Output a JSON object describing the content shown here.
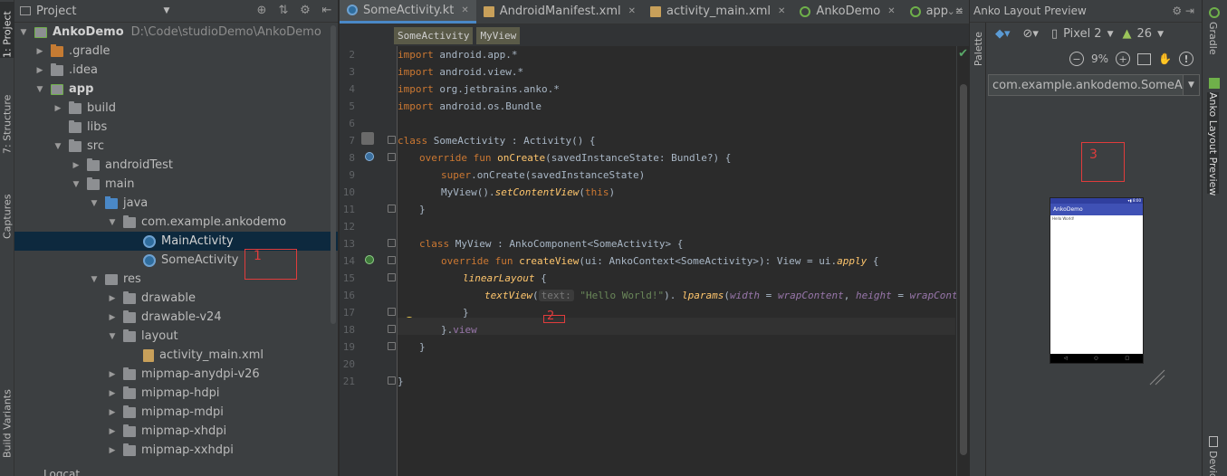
{
  "left_strip": {
    "tabs": [
      "1: Project",
      "7: Structure",
      "Captures",
      "Build Variants"
    ]
  },
  "project": {
    "header_title": "Project",
    "tree": [
      {
        "label": "AnkoDemo",
        "path": "D:\\Code\\studioDemo\\AnkoDemo",
        "expanded": true,
        "icon": "module-icon"
      },
      {
        "label": ".gradle",
        "expanded": false,
        "icon": "folder-icon"
      },
      {
        "label": ".idea",
        "expanded": false,
        "icon": "folder-icon"
      },
      {
        "label": "app",
        "expanded": true,
        "icon": "module-icon"
      },
      {
        "label": "build",
        "expanded": false,
        "icon": "folder-icon"
      },
      {
        "label": "libs",
        "icon": "folder-icon"
      },
      {
        "label": "src",
        "expanded": true,
        "icon": "folder-icon"
      },
      {
        "label": "androidTest",
        "expanded": false,
        "icon": "folder-icon"
      },
      {
        "label": "main",
        "expanded": true,
        "icon": "folder-icon"
      },
      {
        "label": "java",
        "expanded": true,
        "icon": "folder-icon"
      },
      {
        "label": "com.example.ankodemo",
        "expanded": true,
        "icon": "package-icon"
      },
      {
        "label": "MainActivity",
        "icon": "kotlin-class-icon",
        "selected": true
      },
      {
        "label": "SomeActivity",
        "icon": "kotlin-class-icon"
      },
      {
        "label": "res",
        "expanded": true,
        "icon": "folder-icon"
      },
      {
        "label": "drawable",
        "expanded": false,
        "icon": "folder-icon"
      },
      {
        "label": "drawable-v24",
        "expanded": false,
        "icon": "folder-icon"
      },
      {
        "label": "layout",
        "expanded": true,
        "icon": "folder-icon"
      },
      {
        "label": "activity_main.xml",
        "icon": "xml-file-icon"
      },
      {
        "label": "mipmap-anydpi-v26",
        "expanded": false,
        "icon": "folder-icon"
      },
      {
        "label": "mipmap-hdpi",
        "expanded": false,
        "icon": "folder-icon"
      },
      {
        "label": "mipmap-mdpi",
        "expanded": false,
        "icon": "folder-icon"
      },
      {
        "label": "mipmap-xhdpi",
        "expanded": false,
        "icon": "folder-icon"
      },
      {
        "label": "mipmap-xxhdpi",
        "expanded": false,
        "icon": "folder-icon"
      }
    ],
    "bottom_label": "Logcat"
  },
  "annotations": {
    "one": "1",
    "two": "2",
    "three": "3"
  },
  "editor": {
    "tabs": [
      {
        "label": "SomeActivity.kt",
        "active": true
      },
      {
        "label": "AndroidManifest.xml"
      },
      {
        "label": "activity_main.xml"
      },
      {
        "label": "AnkoDemo"
      },
      {
        "label": "app"
      }
    ],
    "breadcrumbs": [
      "SomeActivity",
      "MyView"
    ],
    "line_numbers": [
      "2",
      "3",
      "4",
      "5",
      "6",
      "7",
      "8",
      "9",
      "10",
      "11",
      "12",
      "13",
      "14",
      "15",
      "16",
      "17",
      "18",
      "19",
      "20",
      "21"
    ],
    "code": {
      "l2_kw": "import",
      "l2": " android.app.*",
      "l3_kw": "import",
      "l3": " android.view.*",
      "l4_kw": "import",
      "l4": " org.jetbrains.anko.*",
      "l5_kw": "import",
      "l5": " android.os.Bundle",
      "l7_kw": "class",
      "l7": " SomeActivity : Activity() {",
      "l8_kw": "override fun",
      "l8_fn": "onCreate",
      "l8": "(savedInstanceState: Bundle?) {",
      "l9_kw": "super",
      "l9_dot": ".",
      "l9_fn": "onCreate",
      "l9": "(savedInstanceState)",
      "l10_a": "MyView().",
      "l10_fn": "setContentView",
      "l10_b": "(",
      "l10_kw": "this",
      "l10_c": ")",
      "l11": "}",
      "l13_kw": "class",
      "l13": " MyView : AnkoComponent<SomeActivity> {",
      "l14_kw": "override fun",
      "l14_fn": "createView",
      "l14_a": "(ui: AnkoContext<SomeActivity>): View = ui.",
      "l14_fn2": "apply",
      "l14_b": " {",
      "l15_fn": "linearLayout",
      "l15": " {",
      "l16_fn": "textView",
      "l16_a": "(",
      "l16_hint": "text:",
      "l16_str": "\"Hello World!\"",
      "l16_b": "). ",
      "l16_fn2": "lparams",
      "l16_c": "(",
      "l16_p1": "width",
      "l16_d": " = ",
      "l16_p2": "wrapContent",
      "l16_e": ", ",
      "l16_p3": "height",
      "l16_f": " = ",
      "l16_p4": "wrapContent",
      "l16_g": ")",
      "l17": "}",
      "l18_a": "}.",
      "l18_b": "view",
      "l19": "}",
      "l21": "}"
    }
  },
  "preview": {
    "title": "Anko Layout Preview",
    "device": "Pixel 2",
    "api": "26",
    "zoom": "9%",
    "class_select": "com.example.ankodemo.SomeActivity",
    "phone_app_title": "AnkoDemo",
    "phone_text": "Hello World!",
    "palette_label": "Palette"
  },
  "right_strip": {
    "tabs": [
      "Gradle",
      "Anko Layout Preview",
      "Device"
    ]
  },
  "colors": {
    "accent": "#4a88c7",
    "annotation_red": "#e03c3c",
    "keyword": "#cc7832",
    "function": "#ffc66d",
    "string": "#6a8759"
  }
}
